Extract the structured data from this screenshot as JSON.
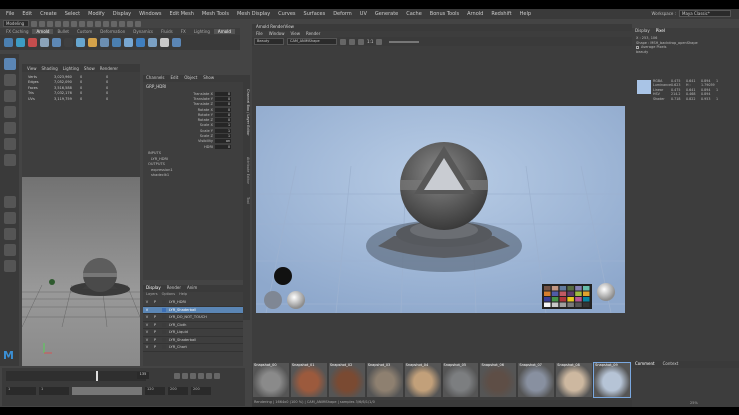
{
  "menubar": {
    "items": [
      "File",
      "Edit",
      "Create",
      "Select",
      "Modify",
      "Display",
      "Windows",
      "Edit Mesh",
      "Mesh Tools",
      "Mesh Display",
      "Curves",
      "Surfaces",
      "Deform",
      "UV",
      "Generate",
      "Cache",
      "Bonus Tools",
      "Arnold",
      "Redshift",
      "Help"
    ],
    "workspace_label": "Workspace :",
    "workspace_value": "Maya Classic*"
  },
  "status": {
    "mode": "Modeling"
  },
  "shelf": {
    "tabs": [
      "FX Caching",
      "Arnold",
      "Bullet",
      "Custom",
      "Deformation",
      "Dynamics",
      "Fluids",
      "FX",
      "Lighting",
      "Arnold"
    ],
    "active": "Arnold",
    "icon_colors": [
      "#4b7fb0",
      "#3d9cc4",
      "#c44d4d",
      "#8ba3b9",
      "#5d87b4",
      "#3f3f3f",
      "#67a6cf",
      "#d4a24a",
      "#6c8fb2",
      "#4b7fb0",
      "#78a7d2",
      "#3f7fc0",
      "#7aa0c4",
      "#c9c9c9",
      "#5b86b5"
    ]
  },
  "viewport": {
    "menu": [
      "View",
      "Shading",
      "Lighting",
      "Show",
      "Renderer"
    ],
    "hud": [
      [
        "Verts",
        "3,023,960",
        "0",
        "0"
      ],
      [
        "Edges",
        "7,052,090",
        "0",
        "0"
      ],
      [
        "Faces",
        "3,516,588",
        "0",
        "0"
      ],
      [
        "Tris",
        "7,032,176",
        "0",
        "0"
      ],
      [
        "UVs",
        "3,119,759",
        "0",
        "0"
      ]
    ]
  },
  "channelbox": {
    "menu": [
      "Channels",
      "Edit",
      "Object",
      "Show"
    ],
    "node": "GRP_HDRI",
    "attrs": [
      [
        "Translate X",
        "0"
      ],
      [
        "Translate Y",
        "0"
      ],
      [
        "Translate Z",
        "0"
      ],
      [
        "Rotate X",
        "0"
      ],
      [
        "Rotate Y",
        "0"
      ],
      [
        "Rotate Z",
        "0"
      ],
      [
        "Scale X",
        "1"
      ],
      [
        "Scale Y",
        "1"
      ],
      [
        "Scale Z",
        "1"
      ],
      [
        "Visibility",
        "on"
      ],
      [
        "HDRI",
        "0"
      ]
    ],
    "inputs_label": "INPUTS",
    "inputs": [
      "LYR_HDRI"
    ],
    "outputs_label": "OUTPUTS",
    "outputs": [
      "expression1",
      "shadeclk1"
    ]
  },
  "side_tabs": [
    "Channel Box / Layer Editor",
    "Attribute Editor",
    "Tool"
  ],
  "layers": {
    "tabs": [
      "Display",
      "Render",
      "Anim"
    ],
    "menu": [
      "Layers",
      "Options",
      "Help"
    ],
    "rows": [
      {
        "v": "V",
        "p": "P",
        "name": "LYR_HDRI",
        "color": "#3c3c3c",
        "active": false
      },
      {
        "v": "V",
        "p": "",
        "name": "LYR_Shaderball",
        "color": "#3d6fb5",
        "active": true
      },
      {
        "v": "V",
        "p": "P",
        "name": "LYR_DO_NOT_TOUCH",
        "color": "#3c3c3c",
        "active": false
      },
      {
        "v": "V",
        "p": "P",
        "name": "LYR_Cloth",
        "color": "#3c3c3c",
        "active": false
      },
      {
        "v": "V",
        "p": "P",
        "name": "LYR_Liquid",
        "color": "#3c3c3c",
        "active": false
      },
      {
        "v": "V",
        "p": "P",
        "name": "LYR_Shaderball",
        "color": "#3c3c3c",
        "active": false
      },
      {
        "v": "V",
        "p": "P",
        "name": "LYR_Chart",
        "color": "#3c3c3c",
        "active": false
      }
    ]
  },
  "timeline": {
    "start": "1",
    "end": "120",
    "range_start": "1",
    "range_end": "120",
    "max_end": "200",
    "alt_end": "200",
    "frame": "1",
    "current": "135"
  },
  "renderview": {
    "title": "Arnold RenderView",
    "menu": [
      "File",
      "Window",
      "View",
      "Render"
    ],
    "aov": "Beauty",
    "camera": "CAM_ANIMShape",
    "ratio": "1:1"
  },
  "snapshots": [
    "Snapshot_00",
    "Snapshot_01",
    "Snapshot_02",
    "Snapshot_03",
    "Snapshot_04",
    "Snapshot_05",
    "Snapshot_06",
    "Snapshot_07",
    "Snapshot_08",
    "Snapshot_09"
  ],
  "snapshot_colors": [
    "#8a8a8a",
    "#9c5a3d",
    "#7a4a32",
    "#8e8070",
    "#c2a07a",
    "#7c7e80",
    "#5e4e46",
    "#8890a0",
    "#cdb8a0",
    "#b6c4d6"
  ],
  "rv_status": "Rendering | 1664x0 (100 %) | CAM_ANIMShape | samples 3/6/6/1/1/0",
  "pixel": {
    "tabs": [
      "Display",
      "Pixel"
    ],
    "xy": "X : 253, 106",
    "shape": "Shape : MSH_backdrop_openShape",
    "avg_label": "Average Pixels",
    "beauty": "beauty",
    "rows": [
      [
        "RGBA",
        "0.475",
        "0.641",
        "0.894",
        "1"
      ],
      [
        "Luminance",
        "0.623",
        "H :",
        "1.79059",
        ""
      ],
      [
        "Linear",
        "0.475",
        "0.641",
        "0.894",
        "1"
      ],
      [
        "HSV",
        "214.2",
        "0.468",
        "0.894",
        ""
      ],
      [
        "Shader",
        "0.718",
        "0.822",
        "0.953",
        "1"
      ]
    ],
    "sample_color": "#a9c4e6"
  },
  "comments": {
    "tabs": [
      "Comment",
      "Context"
    ],
    "zoom": "25%"
  }
}
